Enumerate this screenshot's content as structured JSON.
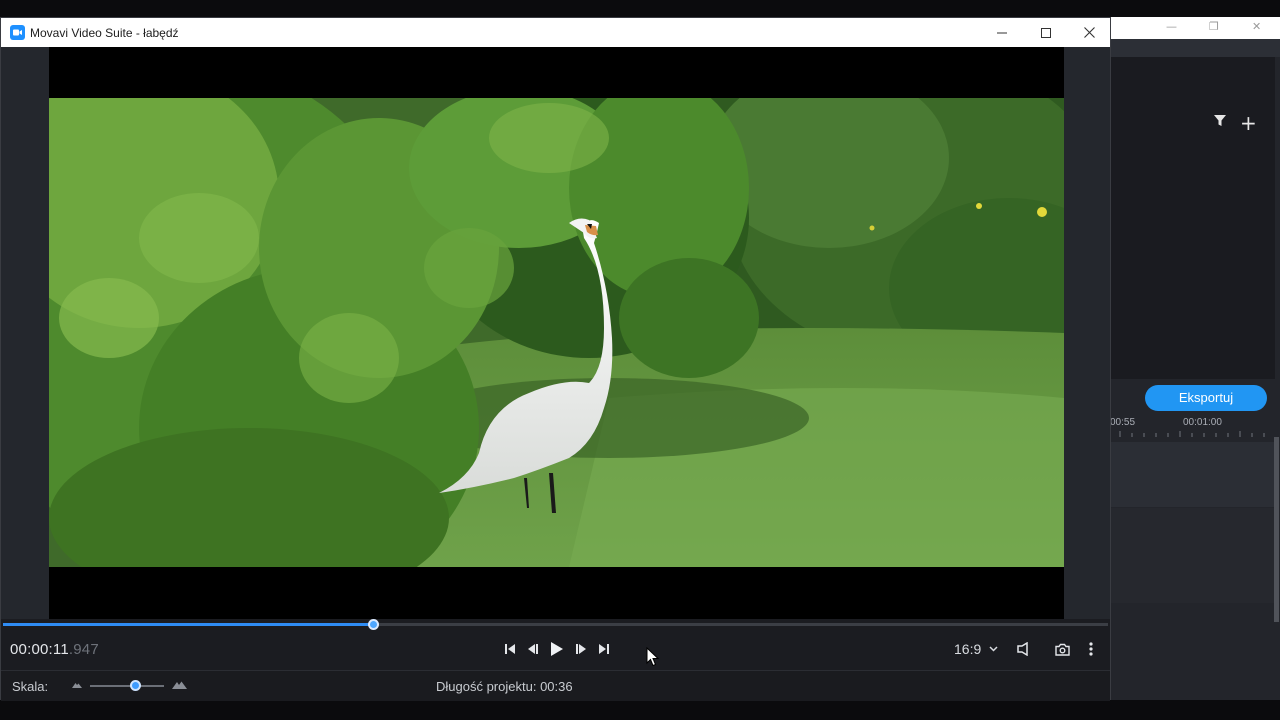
{
  "window": {
    "title": "Movavi Video Suite - łabędź",
    "minimize_icon": "minimize-icon",
    "maximize_icon": "maximize-icon",
    "close_icon": "close-icon"
  },
  "background_app": {
    "export_label": "Eksportuj",
    "ruler_labels": [
      "00:55",
      "00:01:00"
    ],
    "accent": "#2196f3"
  },
  "player": {
    "time_main": "00:00:11",
    "time_ms": ".947",
    "progress": 0.335,
    "aspect_ratio": "16:9",
    "controls": [
      "skip-to-start-icon",
      "previous-frame-icon",
      "play-icon",
      "next-frame-icon",
      "skip-to-end-icon"
    ],
    "right_icons": [
      "fullscreen-icon",
      "snapshot-icon",
      "more-options-icon"
    ]
  },
  "bottom": {
    "scale_label": "Skala:",
    "scale_level": 0.61,
    "duration_label": "Długość projektu:",
    "duration_value": "00:36"
  }
}
